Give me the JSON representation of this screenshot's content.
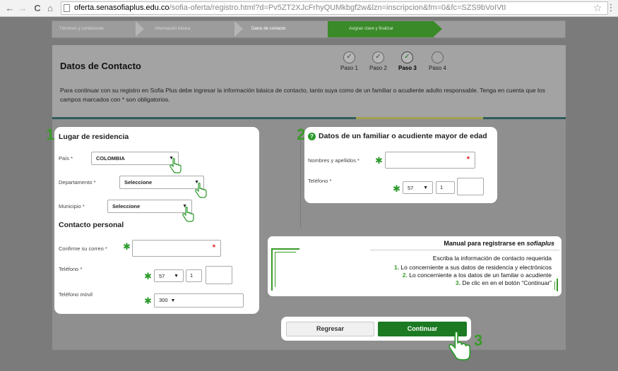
{
  "browser": {
    "back_icon": "arrow-left-icon",
    "forward_icon": "arrow-right-icon",
    "reload_icon": "reload-icon",
    "home_icon": "home-icon",
    "url_host": "oferta.senasofiaplus.edu.co",
    "url_path": "/sofia-oferta/registro.html?d=Pv5ZT2XJcFrhyQUMkbgf2w&lzn=inscripcion&fm=0&fc=SZS9bVoIVtI"
  },
  "steps_bar": {
    "items": [
      {
        "label": "Términos y condiciones"
      },
      {
        "label": "Información básica"
      },
      {
        "label": "Datos de contacto"
      },
      {
        "label": "Asignar clave y finalizar"
      }
    ]
  },
  "header": {
    "title": "Datos de Contacto",
    "intro": "Para continuar con su registro en Sofia Plus debe ingresar la información básica de contacto, tanto suya como de un familiar o acudiente adulto responsable. Tenga en cuenta que los campos marcados con * son obligatorios.",
    "progress": [
      {
        "label": "Paso 1",
        "state": "done"
      },
      {
        "label": "Paso 2",
        "state": "done"
      },
      {
        "label": "Paso 3",
        "state": "current"
      },
      {
        "label": "Paso 4",
        "state": "pending"
      }
    ]
  },
  "residence": {
    "number": "1",
    "title": "Lugar de residencia",
    "country_label": "País *",
    "country_value": "COLOMBIA",
    "department_label": "Departamento *",
    "department_value": "Seleccione",
    "municipality_label": "Municipio *",
    "municipality_value": "Seleccione"
  },
  "personal": {
    "title": "Contacto personal",
    "email_confirm_label": "Confirme su correo *",
    "phone_label": "Teléfono *",
    "phone_code": "57",
    "phone_area": "1",
    "mobile_label": "Teléfono móvil",
    "mobile_value": "300"
  },
  "relative": {
    "number": "2",
    "title": "Datos de un familiar o acudiente mayor de edad",
    "name_label": "Nombres y apellidos *",
    "phone_label": "Teléfono *",
    "phone_code": "57",
    "phone_area": "1"
  },
  "manual": {
    "title_prefix": "Manual para registrarse en ",
    "title_brand": "sofiaplus",
    "intro": "Escriba la información de contacto requerida",
    "items": [
      {
        "num": "1.",
        "text": " Lo concerniente a sus datos de residencia y electrónicos"
      },
      {
        "num": "2.",
        "text": " Lo concerniente a los datos de un familar o acudiente"
      },
      {
        "num": "3.",
        "text": " De clic en en el botón “Continuar”"
      }
    ]
  },
  "actions": {
    "back_label": "Regresar",
    "continue_label": "Continuar",
    "step_number": "3"
  },
  "colors": {
    "accent_green": "#1c7a23",
    "required_red": "#d42020"
  }
}
